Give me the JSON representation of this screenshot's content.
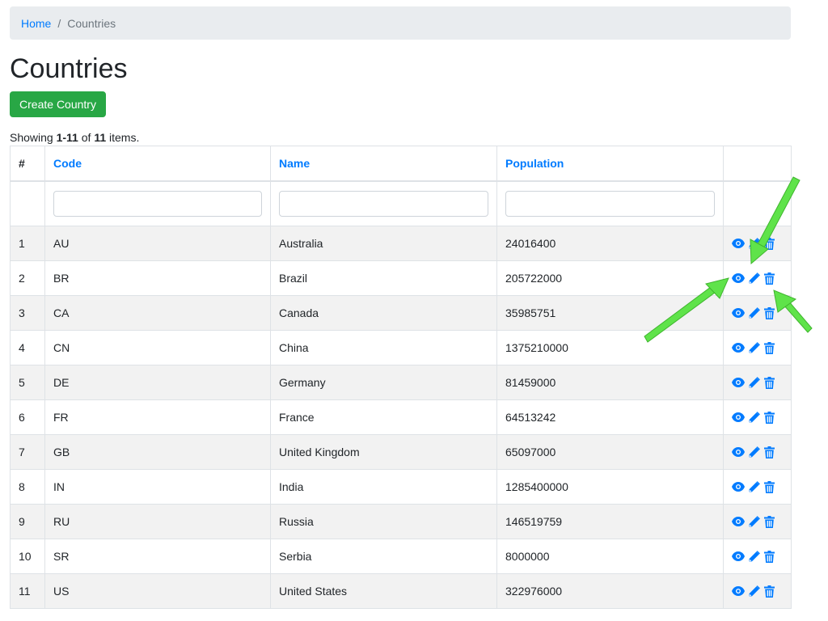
{
  "breadcrumb": {
    "home": "Home",
    "separator": "/",
    "current": "Countries"
  },
  "page_title": "Countries",
  "create_button": "Create Country",
  "summary": {
    "prefix": "Showing ",
    "range": "1-11",
    "middle": " of ",
    "total": "11",
    "suffix": " items."
  },
  "table": {
    "headers": {
      "index": "#",
      "code": "Code",
      "name": "Name",
      "population": "Population"
    },
    "filters": {
      "code": "",
      "name": "",
      "population": ""
    },
    "rows": [
      {
        "index": "1",
        "code": "AU",
        "name": "Australia",
        "population": "24016400"
      },
      {
        "index": "2",
        "code": "BR",
        "name": "Brazil",
        "population": "205722000"
      },
      {
        "index": "3",
        "code": "CA",
        "name": "Canada",
        "population": "35985751"
      },
      {
        "index": "4",
        "code": "CN",
        "name": "China",
        "population": "1375210000"
      },
      {
        "index": "5",
        "code": "DE",
        "name": "Germany",
        "population": "81459000"
      },
      {
        "index": "6",
        "code": "FR",
        "name": "France",
        "population": "64513242"
      },
      {
        "index": "7",
        "code": "GB",
        "name": "United Kingdom",
        "population": "65097000"
      },
      {
        "index": "8",
        "code": "IN",
        "name": "India",
        "population": "1285400000"
      },
      {
        "index": "9",
        "code": "RU",
        "name": "Russia",
        "population": "146519759"
      },
      {
        "index": "10",
        "code": "SR",
        "name": "Serbia",
        "population": "8000000"
      },
      {
        "index": "11",
        "code": "US",
        "name": "United States",
        "population": "322976000"
      }
    ],
    "row_actions": [
      "eye-icon",
      "pencil-icon",
      "trash-icon"
    ]
  },
  "colors": {
    "link": "#007bff",
    "create_button": "#28a745",
    "annotation_arrow": "#5fe34a"
  }
}
